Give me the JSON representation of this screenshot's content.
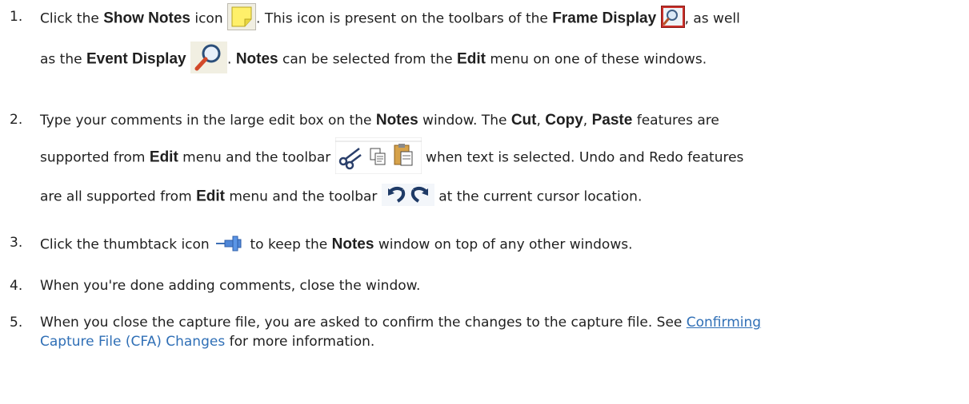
{
  "steps": [
    {
      "num": "1.",
      "a": "Click the ",
      "b_show_notes": "Show Notes",
      "c": " icon ",
      "d": ". This icon is present on the toolbars of the ",
      "b_frame_display": "Frame Display",
      "e": ", as well",
      "f": "as the ",
      "b_event_display": "Event Display",
      "g": ". ",
      "b_notes": "Notes",
      "h": " can be selected from the ",
      "b_edit": "Edit",
      "i": " menu on one of these windows."
    },
    {
      "num": "2.",
      "a": "Type your comments in the large edit box on the ",
      "b_notes": "Notes",
      "b": " window. The ",
      "b_cut": "Cut",
      "c": ", ",
      "b_copy": "Copy",
      "d": ", ",
      "b_paste": "Paste",
      "e": " features are",
      "f": "supported from ",
      "b_edit1": "Edit",
      "g": " menu and the toolbar ",
      "h": " when text is selected. Undo and Redo features",
      "i": "are all supported from ",
      "b_edit2": "Edit",
      "j": " menu and the toolbar ",
      "k": " at the current cursor location."
    },
    {
      "num": "3.",
      "a": "Click the thumbtack icon ",
      "b": " to keep the ",
      "b_notes": "Notes",
      "c": " window on top of any other windows."
    },
    {
      "num": "4.",
      "a": "When you're done adding comments, close the window."
    },
    {
      "num": "5.",
      "a": "When you close the capture file, you are asked to confirm the changes to the capture file. See ",
      "link1": "Confirming",
      "link2": "Capture File (CFA) Changes",
      "b": " for more information."
    }
  ],
  "icons": {
    "show_notes": "sticky-note-icon",
    "frame_display": "frame-display-icon",
    "event_display": "magnifier-icon",
    "cut": "scissors-icon",
    "copy": "copy-icon",
    "paste": "paste-icon",
    "undo": "undo-icon",
    "redo": "redo-icon",
    "pin": "thumbtack-icon"
  },
  "colors": {
    "link": "#2f6fb6",
    "note_yellow": "#fff06a"
  }
}
